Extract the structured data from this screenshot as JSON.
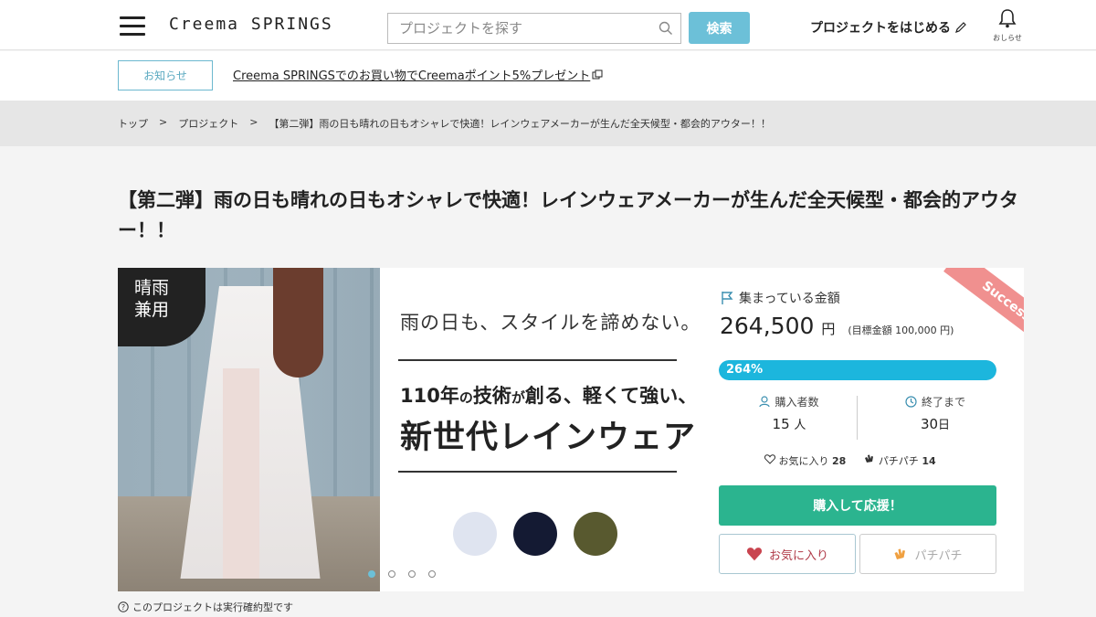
{
  "header": {
    "logo": "Creema SPRINGS",
    "search_placeholder": "プロジェクトを探す",
    "search_button": "検索",
    "start_project": "プロジェクトをはじめる",
    "notifications_label": "おしらせ"
  },
  "notice": {
    "tag": "お知らせ",
    "link": "Creema SPRINGSでのお買い物でCreemaポイント5%プレゼント"
  },
  "breadcrumb": {
    "items": [
      "トップ",
      "プロジェクト",
      "【第二弾】雨の日も晴れの日もオシャレで快適！レインウェアメーカーが生んだ全天候型・都会的アウター！！"
    ],
    "separator": ">"
  },
  "project": {
    "title": "【第二弾】雨の日も晴れの日もオシャレで快適！レインウェアメーカーが生んだ全天候型・都会的アウター！！"
  },
  "hero": {
    "badge_line1": "晴雨",
    "badge_line2": "兼用",
    "tagline": "雨の日も、スタイルを諦めない。",
    "tech_a": "110年",
    "tech_b": "の",
    "tech_c": "技術",
    "tech_d": "が",
    "tech_e": "創る、軽くて強い、",
    "new_generation": "新世代レインウェア",
    "swatch_colors": [
      "#dfe4f0",
      "#141a33",
      "#58592f"
    ],
    "slide_count": 4,
    "active_slide": 0
  },
  "funding": {
    "status_ribbon": "Success",
    "collected_label": "集まっている金額",
    "amount": "264,500",
    "currency": "円",
    "goal_text": "(目標金額 100,000 円)",
    "percent_label": "264%",
    "progress_fraction": 1.0,
    "supporters_label": "購入者数",
    "supporters_value": "15",
    "supporters_unit": "人",
    "days_left_label": "終了まで",
    "days_left_value": "30",
    "days_left_unit": "日",
    "favorites_label": "お気に入り",
    "favorites_count": "28",
    "claps_label": "パチパチ",
    "claps_count": "14",
    "buy_button": "購入して応援！",
    "favorite_button": "お気に入り",
    "clap_button": "パチパチ"
  },
  "footnote": "このプロジェクトは実行確約型です",
  "colors": {
    "accent": "#6cc0d8",
    "progress": "#1cb6dd",
    "buy": "#2bb48f",
    "ribbon": "#f0908f",
    "favorite": "#c9444f"
  }
}
